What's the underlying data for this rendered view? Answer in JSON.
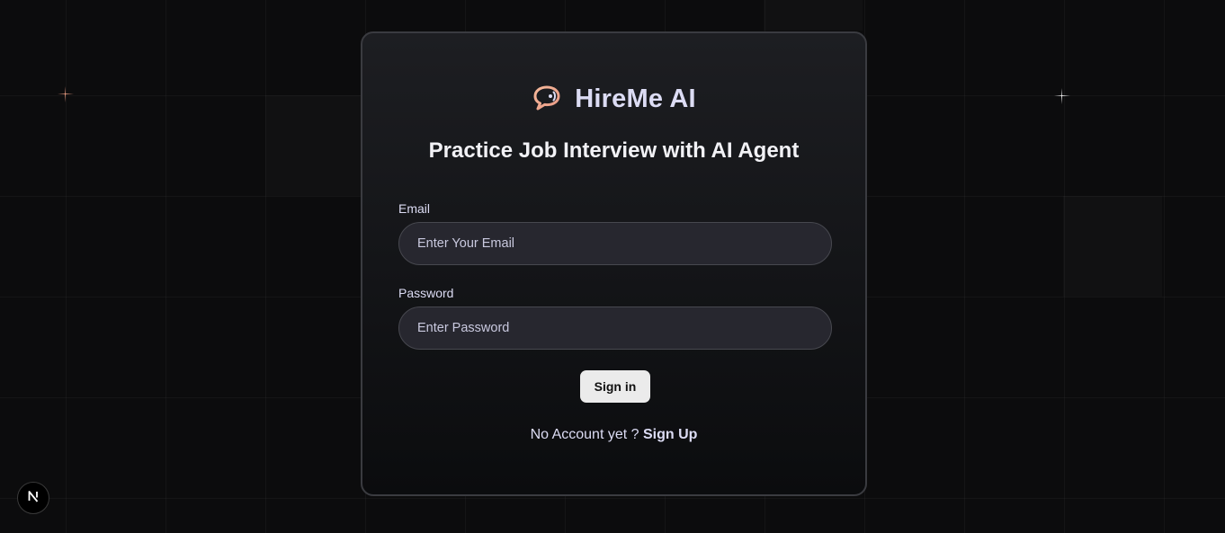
{
  "brand": {
    "name": "HireMe AI",
    "icon": "chat-bubble-voice-icon",
    "accent_color": "#f2a98b"
  },
  "headline": "Practice Job Interview with AI Agent",
  "form": {
    "email": {
      "label": "Email",
      "placeholder": "Enter Your Email",
      "value": ""
    },
    "password": {
      "label": "Password",
      "placeholder": "Enter Password",
      "value": ""
    },
    "submit_label": "Sign in"
  },
  "signup": {
    "prompt": "No Account yet ?",
    "link_label": "Sign Up"
  },
  "dev_badge": {
    "letter": "N",
    "icon": "nextjs-icon"
  }
}
